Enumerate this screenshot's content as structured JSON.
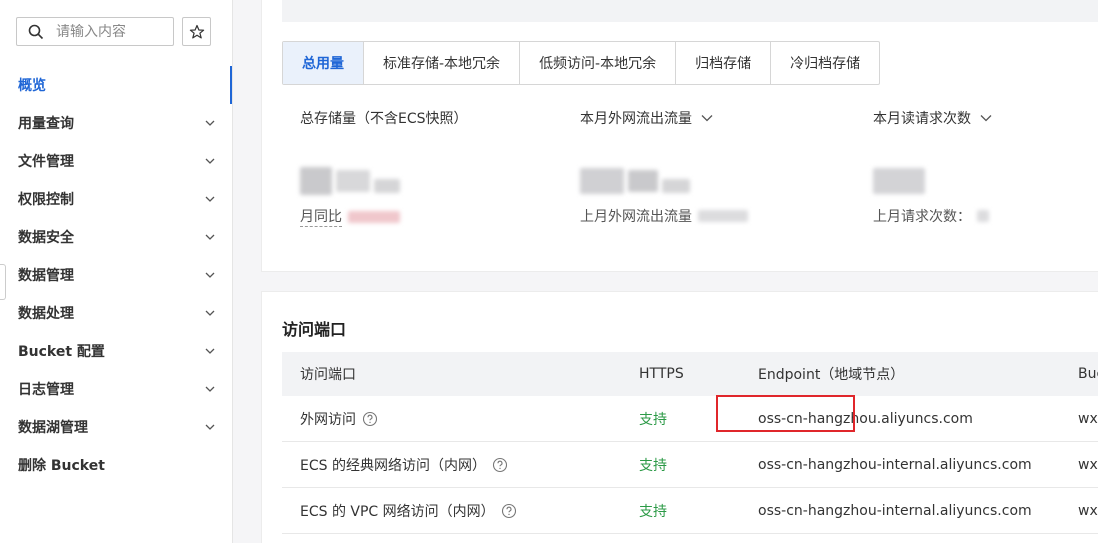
{
  "sidebar": {
    "search_placeholder": "请输入内容",
    "items": [
      {
        "label": "概览",
        "active": true,
        "expandable": false
      },
      {
        "label": "用量查询",
        "expandable": true
      },
      {
        "label": "文件管理",
        "expandable": true
      },
      {
        "label": "权限控制",
        "expandable": true
      },
      {
        "label": "数据安全",
        "expandable": true
      },
      {
        "label": "数据管理",
        "expandable": true
      },
      {
        "label": "数据处理",
        "expandable": true
      },
      {
        "label": "Bucket 配置",
        "expandable": true
      },
      {
        "label": "日志管理",
        "expandable": true
      },
      {
        "label": "数据湖管理",
        "expandable": true
      },
      {
        "label": "删除 Bucket",
        "expandable": false
      }
    ]
  },
  "usage": {
    "tabs": [
      "总用量",
      "标准存储-本地冗余",
      "低频访问-本地冗余",
      "归档存储",
      "冷归档存储"
    ],
    "active_tab": 0,
    "metrics": [
      {
        "label": "总存储量（不含ECS快照）",
        "sub": "月同比"
      },
      {
        "label": "本月外网流出流量",
        "sub": "上月外网流出流量"
      },
      {
        "label": "本月读请求次数",
        "sub": "上月请求次数："
      }
    ]
  },
  "access": {
    "title": "访问端口",
    "columns": [
      "访问端口",
      "HTTPS",
      "Endpoint（地域节点）",
      "Buc"
    ],
    "rows": [
      {
        "name": "外网访问",
        "https": "支持",
        "endpoint": "oss-cn-hangzhou.aliyuncs.com",
        "bucket": "wxv",
        "highlighted": true
      },
      {
        "name": "ECS 的经典网络访问（内网）",
        "https": "支持",
        "endpoint": "oss-cn-hangzhou-internal.aliyuncs.com",
        "bucket": "wxv"
      },
      {
        "name": "ECS 的 VPC 网络访问（内网）",
        "https": "支持",
        "endpoint": "oss-cn-hangzhou-internal.aliyuncs.com",
        "bucket": "wxv"
      }
    ]
  },
  "colors": {
    "accent": "#1f66d6",
    "support": "#2b9a46",
    "highlight": "#e0262b"
  }
}
